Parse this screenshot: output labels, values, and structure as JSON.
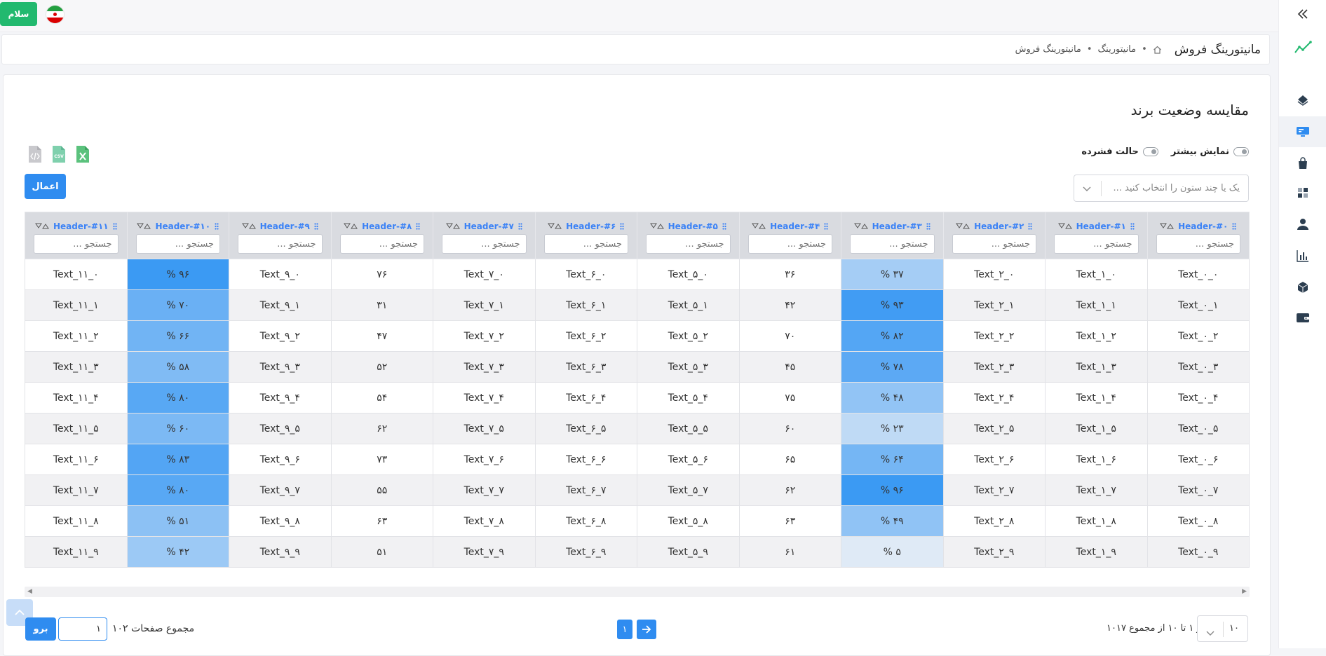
{
  "topbar": {
    "greeting_button": "سلام",
    "flag_icon": "iran-flag-icon"
  },
  "breadcrumb": {
    "page_title": "مانیتورینگ فروش",
    "items": [
      "مانیتورینگ",
      "مانیتورینگ فروش"
    ]
  },
  "sidebar": {
    "icons": [
      "collapse-chevrons-icon",
      "trend-line-icon",
      "layers-icon",
      "monitor-icon",
      "shopping-bag-icon",
      "grid-icon",
      "user-icon",
      "bar-chart-icon",
      "box-icon",
      "wallet-icon"
    ],
    "active": "monitor-icon"
  },
  "card": {
    "title": "مقایسه وضعیت برند",
    "toggle_more": "نمایش بیشتر",
    "toggle_compact": "حالت فشرده",
    "column_select_placeholder": "یک یا چند ستون را انتخاب کنید ...",
    "apply_button": "اعمال",
    "export_icons": [
      "excel-file-icon",
      "csv-file-icon",
      "code-file-icon"
    ]
  },
  "table": {
    "headers": [
      "Header-#۰",
      "Header-#۱",
      "Header-#۲",
      "Header-#۳",
      "Header-#۴",
      "Header-#۵",
      "Header-#۶",
      "Header-#۷",
      "Header-#۸",
      "Header-#۹",
      "Header-#۱۰",
      "Header-#۱۱"
    ],
    "search_placeholder": "جستجو ...",
    "rows": [
      [
        "Text_۰_۰",
        "Text_۱_۰",
        "Text_۲_۰",
        "۳۷ %",
        "۳۶",
        "Text_۵_۰",
        "Text_۶_۰",
        "Text_۷_۰",
        "۷۶",
        "Text_۹_۰",
        "۹۶ %",
        "Text_۱۱_۰"
      ],
      [
        "Text_۰_۱",
        "Text_۱_۱",
        "Text_۲_۱",
        "۹۳ %",
        "۴۲",
        "Text_۵_۱",
        "Text_۶_۱",
        "Text_۷_۱",
        "۳۱",
        "Text_۹_۱",
        "۷۰ %",
        "Text_۱۱_۱"
      ],
      [
        "Text_۰_۲",
        "Text_۱_۲",
        "Text_۲_۲",
        "۸۲ %",
        "۷۰",
        "Text_۵_۲",
        "Text_۶_۲",
        "Text_۷_۲",
        "۴۷",
        "Text_۹_۲",
        "۶۶ %",
        "Text_۱۱_۲"
      ],
      [
        "Text_۰_۳",
        "Text_۱_۳",
        "Text_۲_۳",
        "۷۸ %",
        "۴۵",
        "Text_۵_۳",
        "Text_۶_۳",
        "Text_۷_۳",
        "۵۲",
        "Text_۹_۳",
        "۵۸ %",
        "Text_۱۱_۳"
      ],
      [
        "Text_۰_۴",
        "Text_۱_۴",
        "Text_۲_۴",
        "۴۸ %",
        "۷۵",
        "Text_۵_۴",
        "Text_۶_۴",
        "Text_۷_۴",
        "۵۴",
        "Text_۹_۴",
        "۸۰ %",
        "Text_۱۱_۴"
      ],
      [
        "Text_۰_۵",
        "Text_۱_۵",
        "Text_۲_۵",
        "۲۳ %",
        "۶۰",
        "Text_۵_۵",
        "Text_۶_۵",
        "Text_۷_۵",
        "۶۲",
        "Text_۹_۵",
        "۶۰ %",
        "Text_۱۱_۵"
      ],
      [
        "Text_۰_۶",
        "Text_۱_۶",
        "Text_۲_۶",
        "۶۴ %",
        "۶۵",
        "Text_۵_۶",
        "Text_۶_۶",
        "Text_۷_۶",
        "۷۳",
        "Text_۹_۶",
        "۸۳ %",
        "Text_۱۱_۶"
      ],
      [
        "Text_۰_۷",
        "Text_۱_۷",
        "Text_۲_۷",
        "۹۶ %",
        "۶۲",
        "Text_۵_۷",
        "Text_۶_۷",
        "Text_۷_۷",
        "۵۵",
        "Text_۹_۷",
        "۸۰ %",
        "Text_۱۱_۷"
      ],
      [
        "Text_۰_۸",
        "Text_۱_۸",
        "Text_۲_۸",
        "۴۹ %",
        "۶۳",
        "Text_۵_۸",
        "Text_۶_۸",
        "Text_۷_۸",
        "۶۳",
        "Text_۹_۸",
        "۵۱ %",
        "Text_۱۱_۸"
      ],
      [
        "Text_۰_۹",
        "Text_۱_۹",
        "Text_۲_۹",
        "۵ %",
        "۶۱",
        "Text_۵_۹",
        "Text_۶_۹",
        "Text_۷_۹",
        "۵۱",
        "Text_۹_۹",
        "۴۲ %",
        "Text_۱۱_۹"
      ]
    ],
    "heat_columns": [
      3,
      10
    ],
    "heat_values": {
      "3": [
        37,
        93,
        82,
        78,
        48,
        23,
        64,
        96,
        49,
        5
      ],
      "10": [
        96,
        70,
        66,
        58,
        80,
        60,
        83,
        80,
        51,
        42
      ]
    }
  },
  "pagination": {
    "goto_button": "برو",
    "page_input_value": "۱",
    "total_pages_text": "مجموع صفحات ۱۰۲",
    "current_page": "۱",
    "range_text": "از ۱ تا ۱۰ از مجموع ۱۰۱۷",
    "per_page": "۱۰"
  },
  "colors": {
    "accent": "#2f8cf0",
    "greeting": "#22b96f",
    "header_bg": "#d9dbe0",
    "header_text": "#3b82f6"
  }
}
